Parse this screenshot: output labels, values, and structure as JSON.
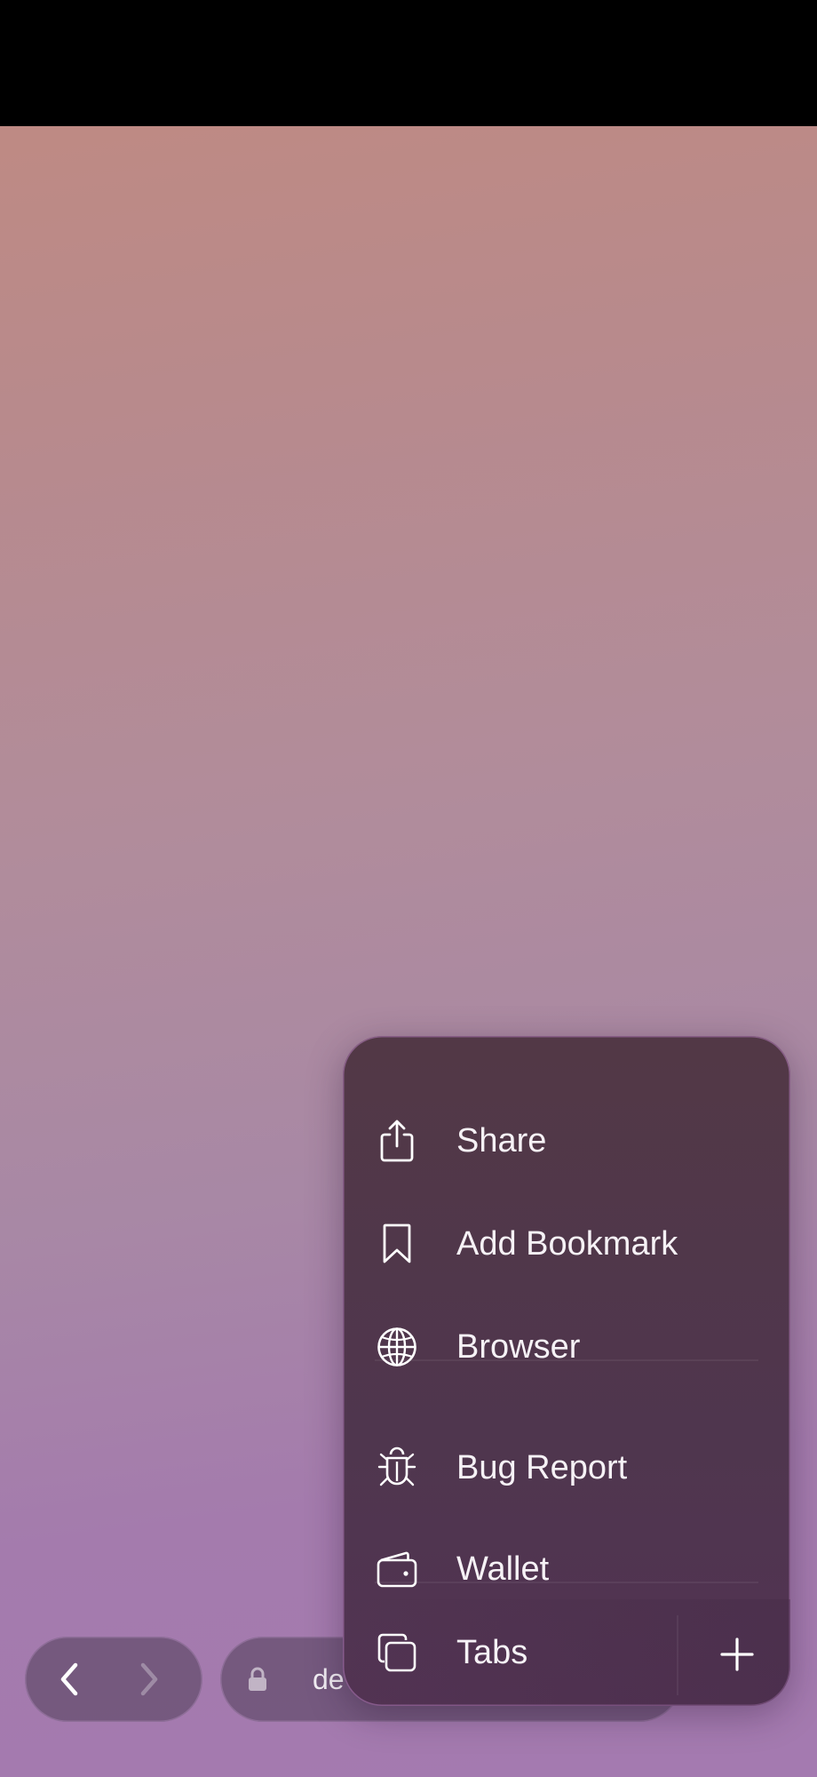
{
  "toolbar": {
    "url_text": "de"
  },
  "menu": {
    "items": [
      {
        "label": "Share",
        "icon": "share-icon"
      },
      {
        "label": "Add Bookmark",
        "icon": "bookmark-icon"
      },
      {
        "label": "Browser",
        "icon": "globe-icon"
      },
      {
        "label": "Bug Report",
        "icon": "bug-icon"
      },
      {
        "label": "Wallet",
        "icon": "wallet-icon"
      },
      {
        "label": "Tabs",
        "icon": "tabs-icon"
      }
    ],
    "new_tab_icon": "plus-icon"
  },
  "colors": {
    "menu_background": "#50364c",
    "status_bar": "#000000",
    "gradient_top": "#c18a80",
    "gradient_bottom": "#a47ab0"
  }
}
